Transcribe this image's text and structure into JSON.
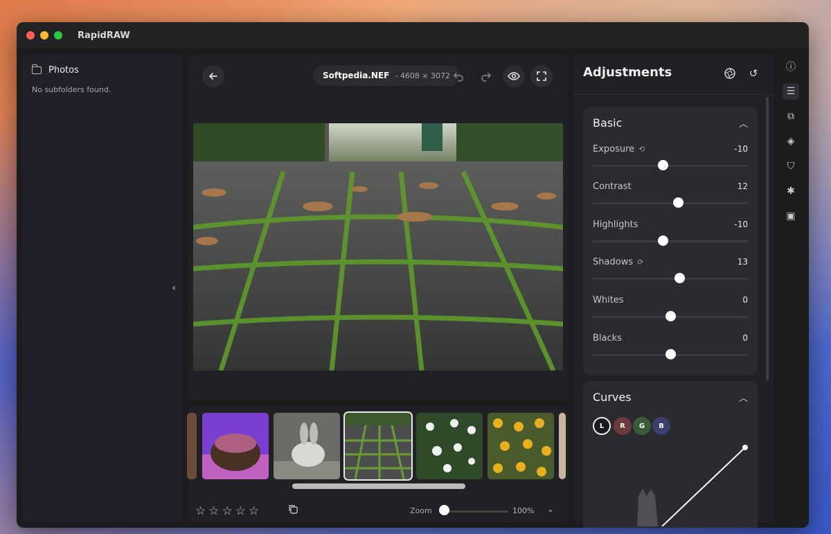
{
  "window": {
    "title": "RapidRAW"
  },
  "sidebar": {
    "folder": "Photos",
    "empty_text": "No subfolders found.",
    "collapse_icon": "chevron-left-icon"
  },
  "viewer": {
    "file_name": "Softpedia.NEF",
    "file_dims": "- 4608 × 3072",
    "icons": [
      "back-arrow-icon",
      "undo-icon",
      "redo-icon",
      "eye-icon",
      "fullscreen-icon"
    ]
  },
  "filmstrip": {
    "rating": 0,
    "zoom_label": "Zoom",
    "zoom_value": "100%",
    "zoom_level": 0.0,
    "selected_index": 2
  },
  "adjustments": {
    "title": "Adjustments",
    "basic": {
      "title": "Basic",
      "items": [
        {
          "label": "Exposure",
          "value": "-10",
          "level": 0.45,
          "reset": true
        },
        {
          "label": "Contrast",
          "value": "12",
          "level": 0.55,
          "reset": false
        },
        {
          "label": "Highlights",
          "value": "-10",
          "level": 0.45,
          "reset": false
        },
        {
          "label": "Shadows",
          "value": "13",
          "level": 0.56,
          "reset": true
        },
        {
          "label": "Whites",
          "value": "0",
          "level": 0.5,
          "reset": false
        },
        {
          "label": "Blacks",
          "value": "0",
          "level": 0.5,
          "reset": false
        }
      ]
    },
    "curves": {
      "title": "Curves",
      "channels": [
        "L",
        "R",
        "G",
        "B"
      ],
      "channel_colors": [
        "#1a1a1e",
        "#6b3b3b",
        "#3b5a3b",
        "#3b3f6b"
      ]
    }
  },
  "rail": {
    "icons": [
      "info-icon",
      "sliders-icon",
      "crop-icon",
      "layers-icon",
      "bookmark-icon",
      "ai-icon",
      "save-icon"
    ]
  },
  "colors": {
    "accent": "#ffffff",
    "panel": "#202025",
    "section": "#2a2a2f"
  }
}
